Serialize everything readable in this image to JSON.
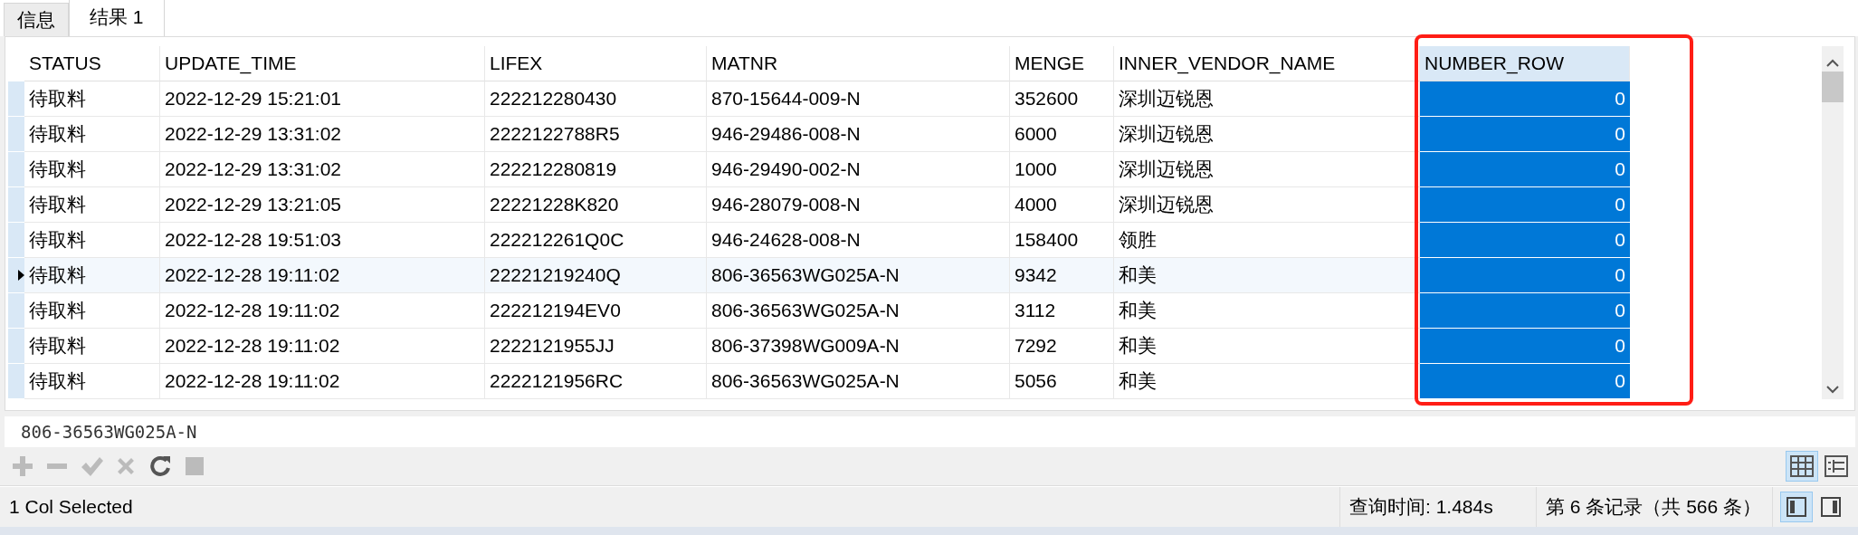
{
  "tabs": [
    {
      "label": "信息",
      "selected": false
    },
    {
      "label": "结果 1",
      "selected": true
    }
  ],
  "table": {
    "columns": [
      {
        "label": "STATUS",
        "selected": false
      },
      {
        "label": "UPDATE_TIME",
        "selected": false
      },
      {
        "label": "LIFEX",
        "selected": false
      },
      {
        "label": "MATNR",
        "selected": false
      },
      {
        "label": "MENGE",
        "selected": false
      },
      {
        "label": "INNER_VENDOR_NAME",
        "selected": false
      },
      {
        "label": "NUMBER_ROW",
        "selected": true
      }
    ],
    "rows": [
      {
        "current": false,
        "cells": [
          "待取料",
          "2022-12-29 15:21:01",
          "222212280430",
          "870-15644-009-N",
          "352600",
          "深圳迈锐恩",
          "0"
        ]
      },
      {
        "current": false,
        "cells": [
          "待取料",
          "2022-12-29 13:31:02",
          "2222122788R5",
          "946-29486-008-N",
          "6000",
          "深圳迈锐恩",
          "0"
        ]
      },
      {
        "current": false,
        "cells": [
          "待取料",
          "2022-12-29 13:31:02",
          "222212280819",
          "946-29490-002-N",
          "1000",
          "深圳迈锐恩",
          "0"
        ]
      },
      {
        "current": false,
        "cells": [
          "待取料",
          "2022-12-29 13:21:05",
          "22221228K820",
          "946-28079-008-N",
          "4000",
          "深圳迈锐恩",
          "0"
        ]
      },
      {
        "current": false,
        "cells": [
          "待取料",
          "2022-12-28 19:51:03",
          "222212261Q0C",
          "946-24628-008-N",
          "158400",
          "领胜",
          "0"
        ]
      },
      {
        "current": true,
        "cells": [
          "待取料",
          "2022-12-28 19:11:02",
          "22221219240Q",
          "806-36563WG025A-N",
          "9342",
          "和美",
          "0"
        ]
      },
      {
        "current": false,
        "cells": [
          "待取料",
          "2022-12-28 19:11:02",
          "222212194EV0",
          "806-36563WG025A-N",
          "3112",
          "和美",
          "0"
        ]
      },
      {
        "current": false,
        "cells": [
          "待取料",
          "2022-12-28 19:11:02",
          "2222121955JJ",
          "806-37398WG009A-N",
          "7292",
          "和美",
          "0"
        ]
      },
      {
        "current": false,
        "cells": [
          "待取料",
          "2022-12-28 19:11:02",
          "2222121956RC",
          "806-36563WG025A-N",
          "5056",
          "和美",
          "0"
        ]
      }
    ]
  },
  "cell_editor": {
    "value": "806-36563WG025A-N"
  },
  "toolbar": [
    {
      "kind": "add",
      "disabled": true
    },
    {
      "kind": "delete",
      "disabled": true
    },
    {
      "kind": "apply",
      "disabled": true
    },
    {
      "kind": "cancel",
      "disabled": true
    },
    {
      "kind": "refresh",
      "disabled": false
    },
    {
      "kind": "stop",
      "disabled": true
    }
  ],
  "view_buttons": [
    {
      "kind": "grid",
      "selected": true
    },
    {
      "kind": "form",
      "selected": false
    }
  ],
  "status_bar": {
    "selection": "1 Col Selected",
    "query_time": "查询时间: 1.484s",
    "record": "第 6 条记录（共 566 条）",
    "layout_buttons": [
      {
        "kind": "left",
        "selected": true
      },
      {
        "kind": "right",
        "selected": false
      }
    ]
  }
}
